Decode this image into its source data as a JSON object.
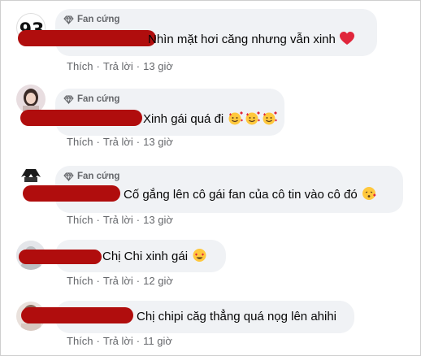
{
  "badge_label": "Fan cứng",
  "like_label": "Thích",
  "reply_label": "Trả lời",
  "separator": "·",
  "comments": [
    {
      "text": "Nhìn mặt hơi căng nhưng vẫn xinh",
      "emoji": [
        "red-heart-icon"
      ],
      "time": "13 giờ",
      "badge": true
    },
    {
      "text": "Xinh gái quá đi",
      "emoji": [
        "smiling-face-with-hearts-icon",
        "smiling-face-with-hearts-icon",
        "smiling-face-with-hearts-icon"
      ],
      "time": "13 giờ",
      "badge": true
    },
    {
      "text": "Cố gắng lên cô gái fan của cô tin vào cô đó",
      "emoji": [
        "face-blowing-kiss-icon"
      ],
      "time": "13 giờ",
      "badge": true
    },
    {
      "text": "Chị Chi xinh gái",
      "emoji": [
        "heart-eyes-icon"
      ],
      "time": "12 giờ",
      "badge": false
    },
    {
      "text": "Chị chipi căg thẳng quá nọg lên ahihi",
      "emoji": [],
      "time": "11 giờ",
      "badge": false
    }
  ],
  "colors": {
    "bubble": "#f0f2f5",
    "redaction": "#b00d0d",
    "meta_text": "#65676b",
    "body_text": "#050505"
  }
}
